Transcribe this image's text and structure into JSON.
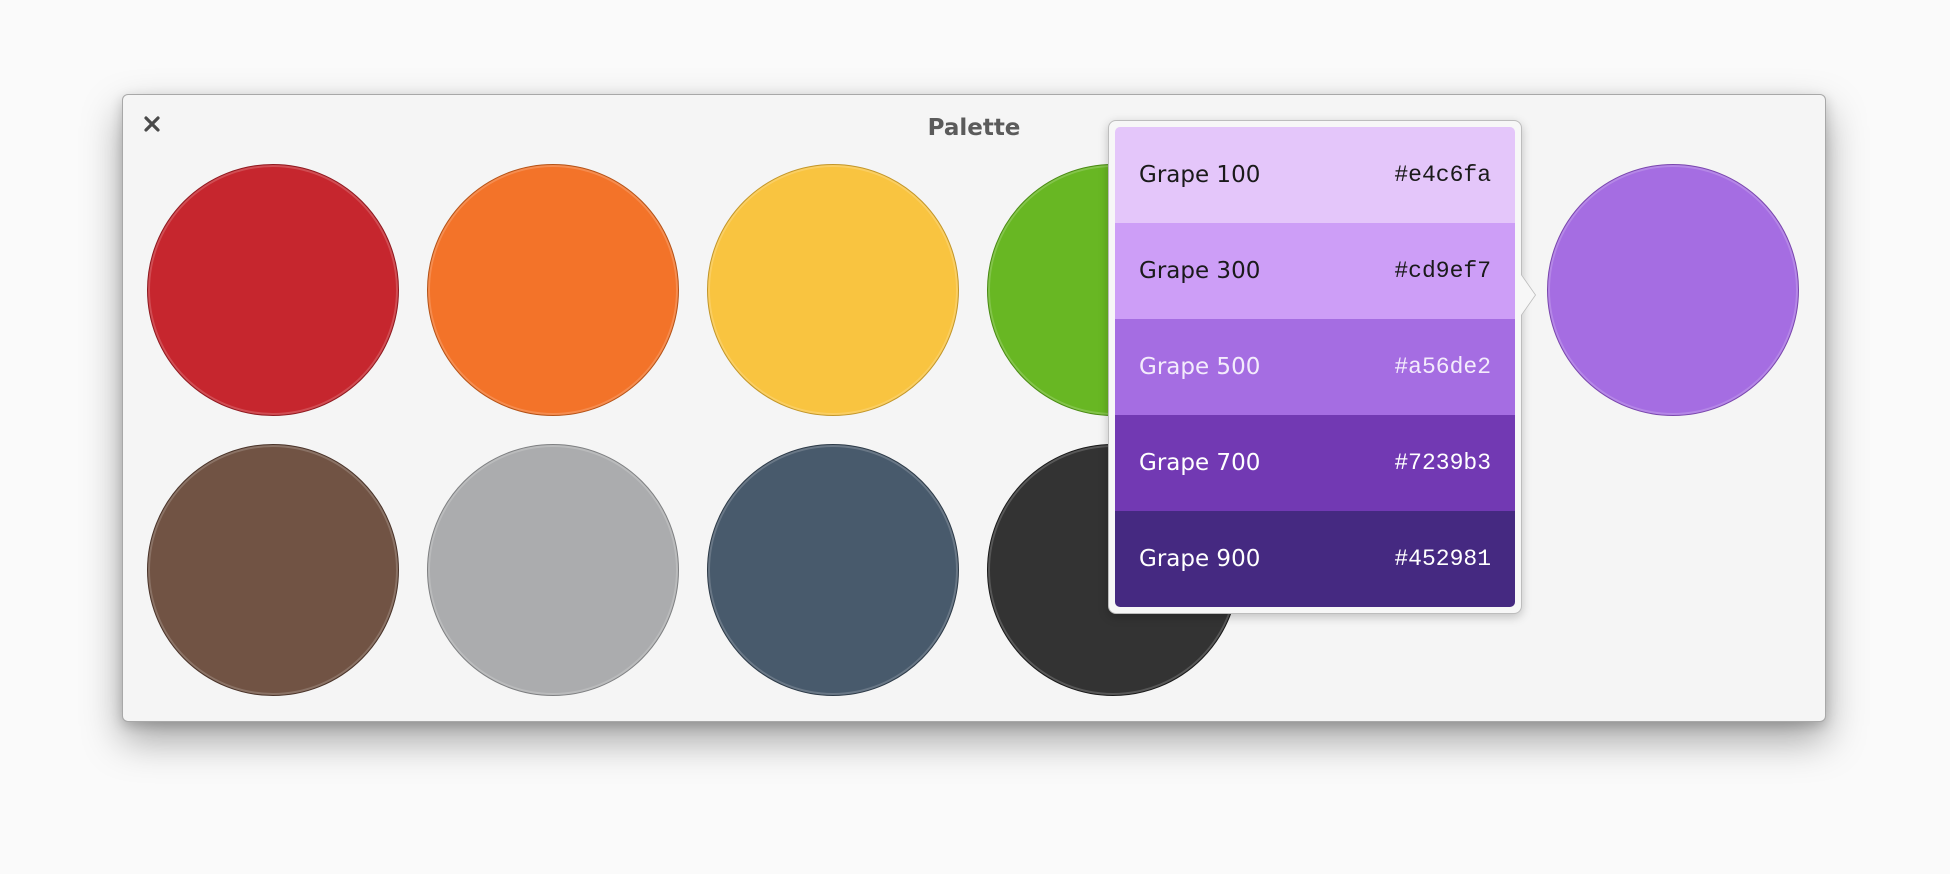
{
  "window": {
    "title": "Palette",
    "close_icon": "close-icon"
  },
  "swatches": [
    {
      "name": "strawberry",
      "color": "#c6262e",
      "border": "#8e1a20"
    },
    {
      "name": "orange",
      "color": "#f37329",
      "border": "#b45318"
    },
    {
      "name": "banana",
      "color": "#f9c440",
      "border": "#c2962a"
    },
    {
      "name": "lime",
      "color": "#68b723",
      "border": "#4a8a14"
    },
    {
      "name": "grape",
      "color": "#a56de2",
      "border": "#7a47ad"
    },
    {
      "name": "cocoa",
      "color": "#715344",
      "border": "#4a342a"
    },
    {
      "name": "silver",
      "color": "#abacae",
      "border": "#7f8082"
    },
    {
      "name": "slate",
      "color": "#485a6c",
      "border": "#2e3b48"
    },
    {
      "name": "black",
      "color": "#333333",
      "border": "#1a1a1a"
    }
  ],
  "popover": {
    "shades": [
      {
        "label": "Grape 100",
        "hex": "#e4c6fa",
        "text_color": "#1a1a1a"
      },
      {
        "label": "Grape 300",
        "hex": "#cd9ef7",
        "text_color": "#1a1a1a"
      },
      {
        "label": "Grape 500",
        "hex": "#a56de2",
        "text_color": "#f4ecfc"
      },
      {
        "label": "Grape 700",
        "hex": "#7239b3",
        "text_color": "#ffffff"
      },
      {
        "label": "Grape 900",
        "hex": "#452981",
        "text_color": "#ffffff"
      }
    ]
  }
}
